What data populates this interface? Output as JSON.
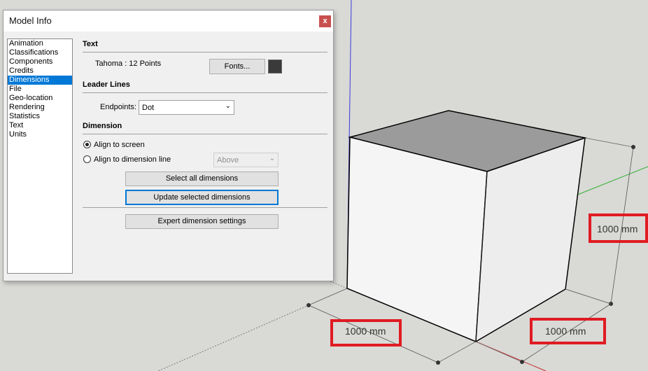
{
  "dialog": {
    "title": "Model Info",
    "close_label": "x"
  },
  "nav": {
    "items": [
      "Animation",
      "Classifications",
      "Components",
      "Credits",
      "Dimensions",
      "File",
      "Geo-location",
      "Rendering",
      "Statistics",
      "Text",
      "Units"
    ],
    "selected": "Dimensions"
  },
  "text_section": {
    "title": "Text",
    "font_value": "Tahoma : 12 Points",
    "fonts_button": "Fonts...",
    "color": "#3a3a3a"
  },
  "leader_section": {
    "title": "Leader Lines",
    "endpoints_label": "Endpoints:",
    "endpoints_value": "Dot"
  },
  "dimension_section": {
    "title": "Dimension",
    "align_screen_label": "Align to screen",
    "align_line_label": "Align to dimension line",
    "align_line_option": "Above",
    "select_all_button": "Select all dimensions",
    "update_selected_button": "Update selected dimensions",
    "expert_button": "Expert dimension settings"
  },
  "viewport": {
    "dim_right": "1000 mm",
    "dim_bottom_left": "1000 mm",
    "dim_bottom_right": "1000 mm",
    "highlight_color": "#e01b22",
    "arrow_color": "#e01b22"
  }
}
